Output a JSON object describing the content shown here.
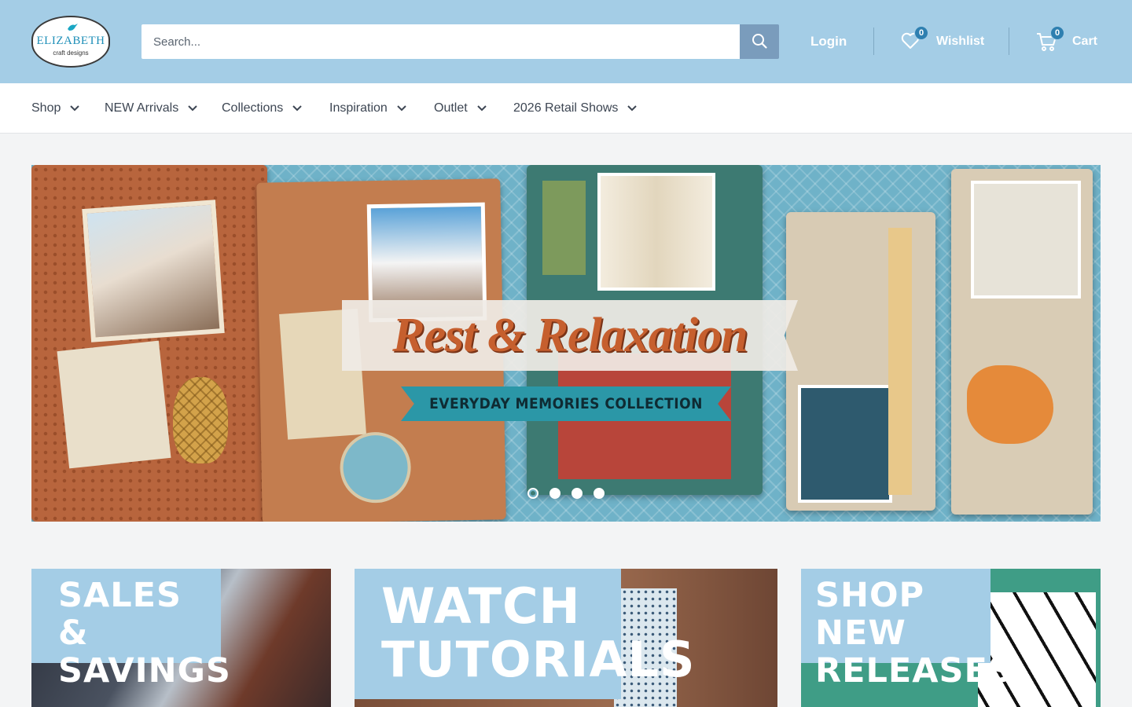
{
  "brand": {
    "logo_main": "ELIZABETH",
    "logo_sub": "craft designs"
  },
  "header": {
    "search_placeholder": "Search...",
    "login": "Login",
    "wishlist": {
      "label": "Wishlist",
      "count": "0"
    },
    "cart": {
      "label": "Cart",
      "count": "0"
    }
  },
  "nav": {
    "items": [
      {
        "label": "Shop"
      },
      {
        "label": "NEW Arrivals"
      },
      {
        "label": "Collections"
      },
      {
        "label": "Inspiration"
      },
      {
        "label": "Outlet"
      },
      {
        "label": "2026 Retail Shows"
      }
    ]
  },
  "hero": {
    "title": "Rest & Relaxation",
    "subtitle": "EVERYDAY MEMORIES COLLECTION",
    "slides": 4,
    "active_slide": 1
  },
  "tiles": [
    {
      "label": "SALES & SAVINGS"
    },
    {
      "label": "WATCH TUTORIALS"
    },
    {
      "label": "SHOP NEW RELEASES"
    }
  ],
  "colors": {
    "header_bg": "#a4cde6",
    "search_button": "#7a9cbc",
    "count_badge": "#2e7fb0",
    "hero_title": "#c65f2e",
    "ribbon": "#2b97a7"
  }
}
